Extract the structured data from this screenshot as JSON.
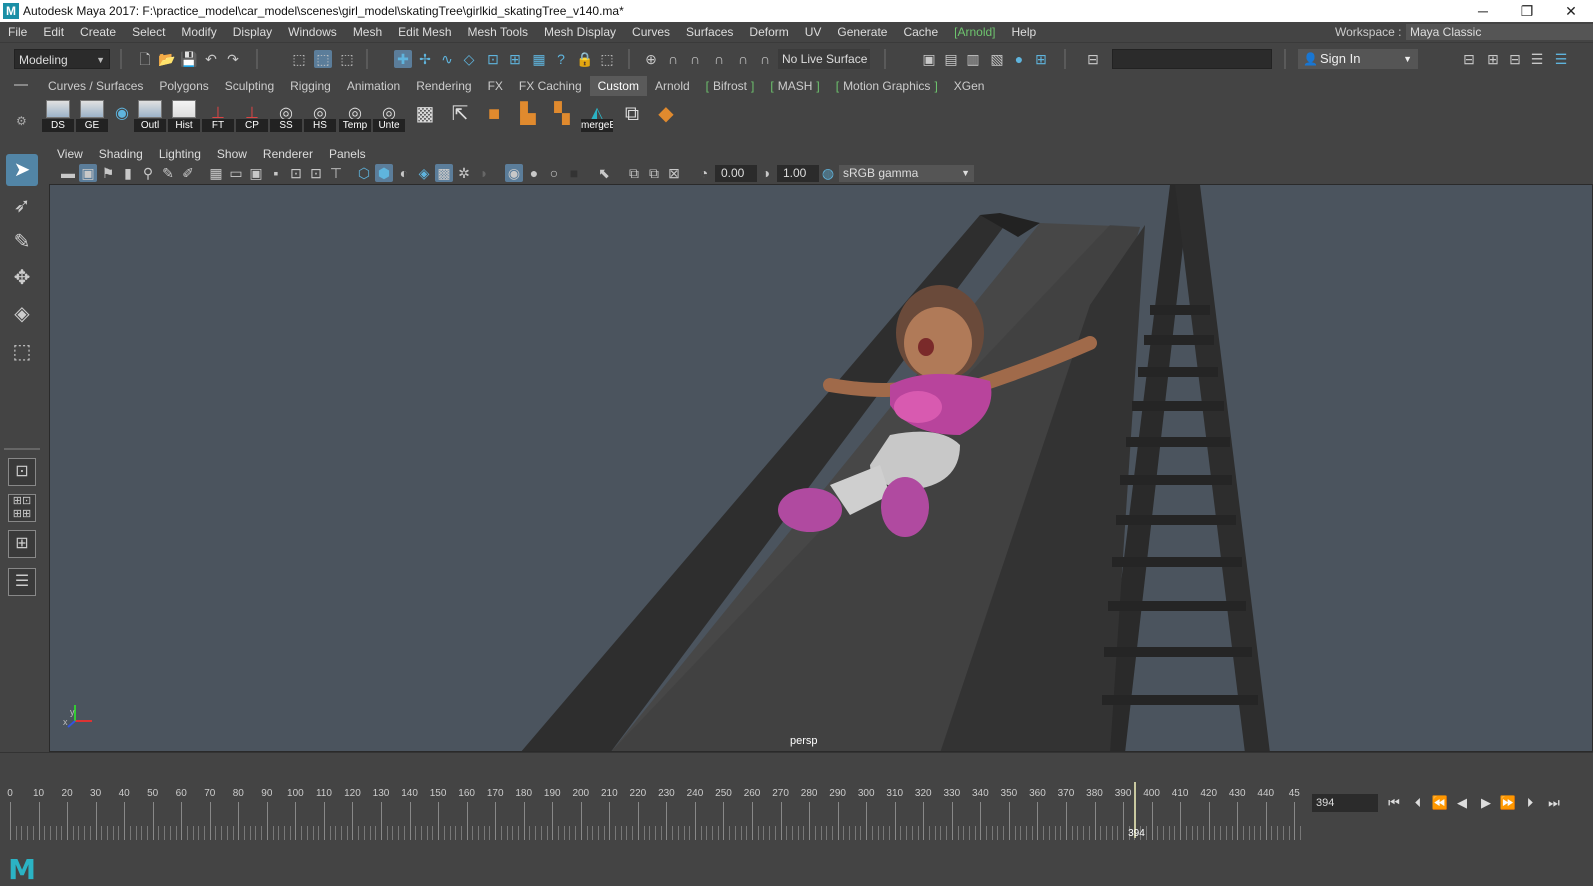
{
  "window": {
    "title": "Autodesk Maya 2017: F:\\practice_model\\car_model\\scenes\\girl_model\\skatingTree\\girlkid_skatingTree_v140.ma*",
    "logo_letter": "M",
    "minimize": "─",
    "restore": "❐",
    "close": "✕"
  },
  "menubar": {
    "items": [
      "File",
      "Edit",
      "Create",
      "Select",
      "Modify",
      "Display",
      "Windows",
      "Mesh",
      "Edit Mesh",
      "Mesh Tools",
      "Mesh Display",
      "Curves",
      "Surfaces",
      "Deform",
      "UV",
      "Generate",
      "Cache",
      "[Arnold]",
      "Help"
    ],
    "workspace_label": "Workspace :",
    "workspace_value": "Maya Classic"
  },
  "statusline": {
    "menuset": "Modeling",
    "live_surface": "No Live Surface",
    "sign_in": "Sign In"
  },
  "shelf_tabs": {
    "tabs": [
      "Curves / Surfaces",
      "Polygons",
      "Sculpting",
      "Rigging",
      "Animation",
      "Rendering",
      "FX",
      "FX Caching",
      "Custom",
      "Arnold",
      "Bifrost",
      "MASH",
      "Motion Graphics",
      "XGen"
    ],
    "active": "Custom"
  },
  "shelf": {
    "buttons": [
      "DS",
      "GE",
      "",
      "Outl",
      "Hist",
      "FT",
      "CP",
      "SS",
      "HS",
      "Temp",
      "Unte",
      "",
      "",
      "",
      "",
      "",
      "mergeE",
      "",
      ""
    ]
  },
  "panel_menu": {
    "items": [
      "View",
      "Shading",
      "Lighting",
      "Show",
      "Renderer",
      "Panels"
    ]
  },
  "panel_toolbar": {
    "exposure": "0.00",
    "gamma": "1.00",
    "color_space": "sRGB gamma"
  },
  "viewport": {
    "camera": "persp",
    "axis_x": "x",
    "axis_y": "y",
    "background": "#4b545e"
  },
  "timeline": {
    "tick_labels": [
      "0",
      "10",
      "20",
      "30",
      "40",
      "50",
      "60",
      "70",
      "80",
      "90",
      "100",
      "110",
      "120",
      "130",
      "140",
      "150",
      "160",
      "170",
      "180",
      "190",
      "200",
      "210",
      "220",
      "230",
      "240",
      "250",
      "260",
      "270",
      "280",
      "290",
      "300",
      "310",
      "320",
      "330",
      "340",
      "350",
      "360",
      "370",
      "380",
      "390",
      "400",
      "410",
      "420",
      "430",
      "440",
      "45"
    ],
    "start": 0,
    "end": 452,
    "current_frame": 394,
    "current_frame_label": "394",
    "frame_field": "394"
  },
  "colors": {
    "accent": "#5285a6",
    "arnold_green": "#6ec46e",
    "key_orange": "#e08a2e"
  }
}
